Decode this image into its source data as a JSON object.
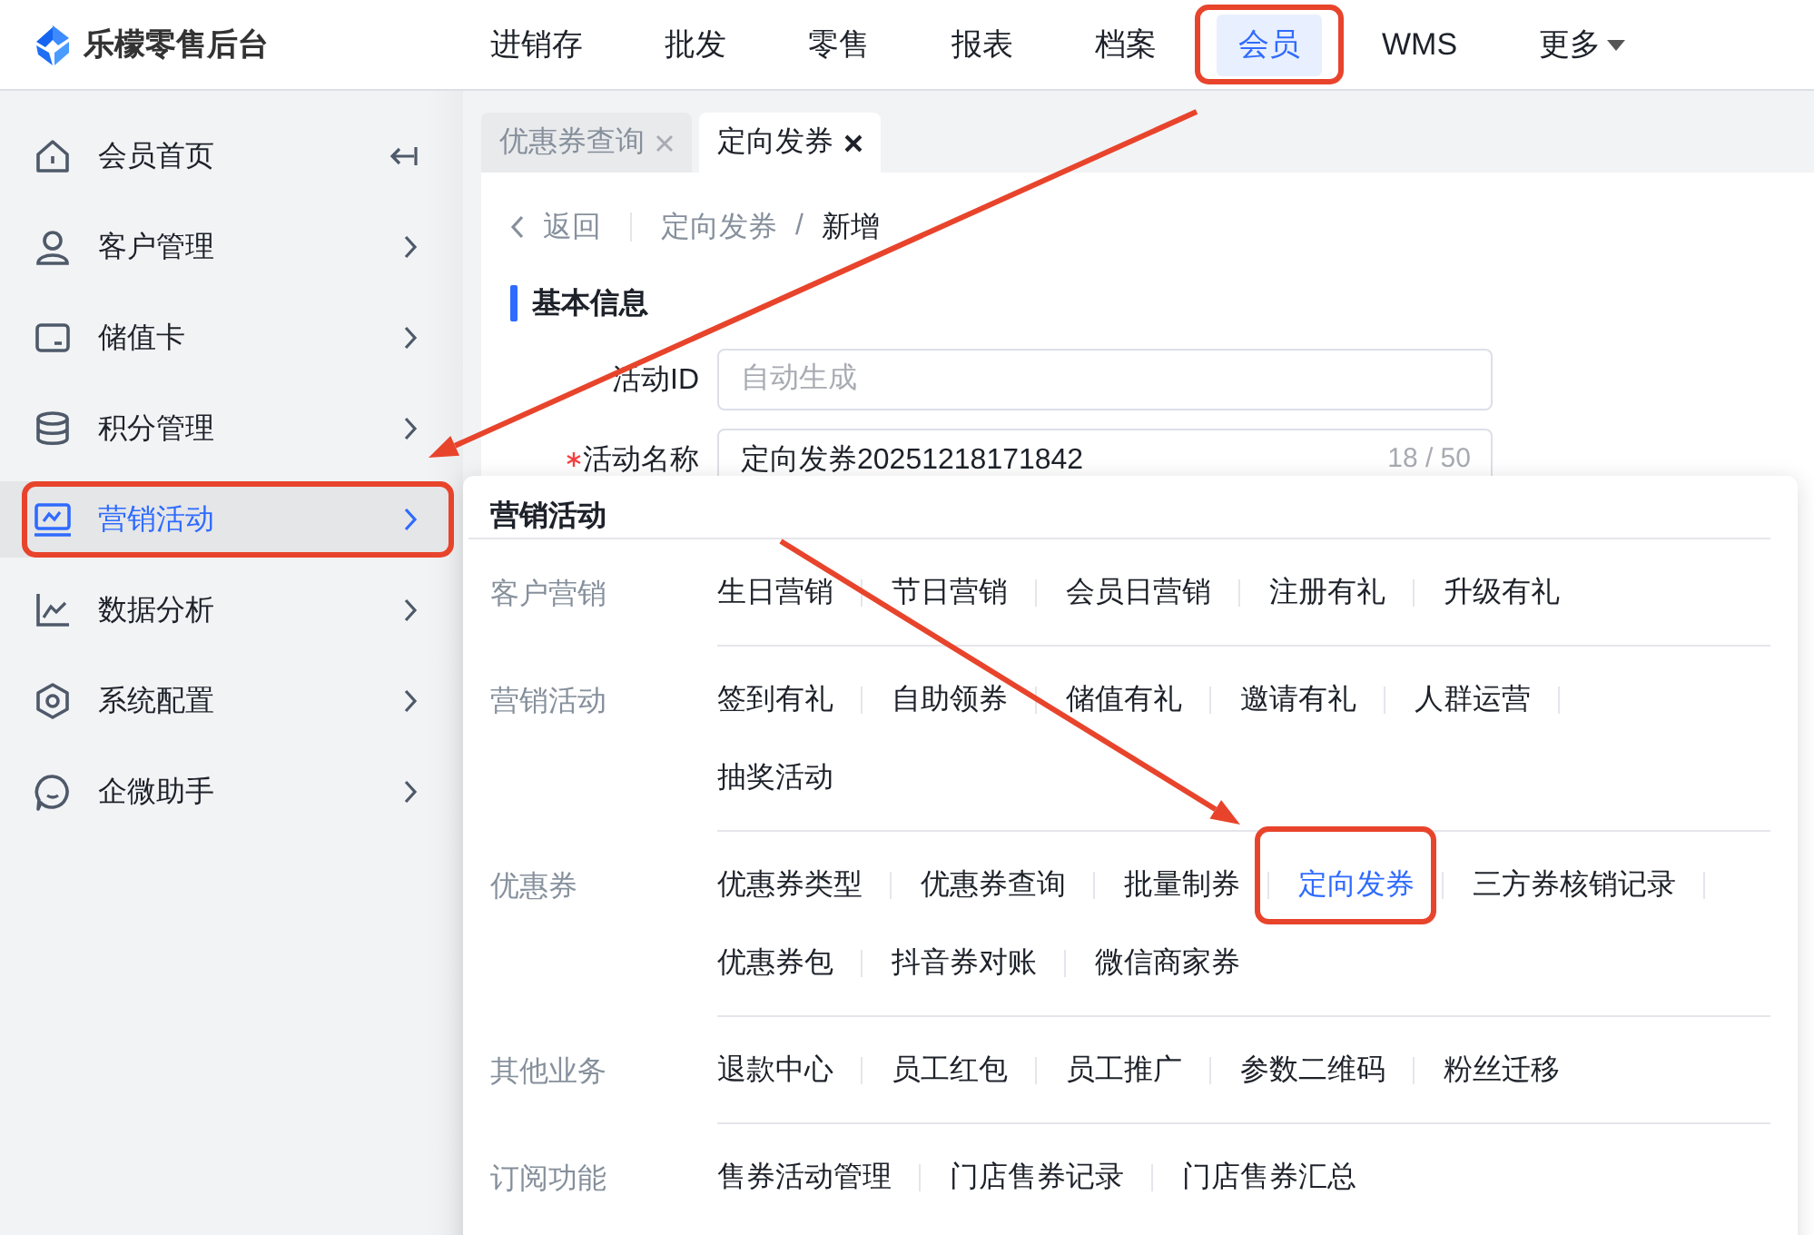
{
  "app": {
    "title": "乐檬零售后台"
  },
  "nav": [
    {
      "label": "进销存",
      "kind": "link",
      "selected": false,
      "highlighted": false
    },
    {
      "label": "批发",
      "kind": "link",
      "selected": false,
      "highlighted": false
    },
    {
      "label": "零售",
      "kind": "link",
      "selected": false,
      "highlighted": false
    },
    {
      "label": "报表",
      "kind": "link",
      "selected": false,
      "highlighted": false
    },
    {
      "label": "档案",
      "kind": "link",
      "selected": false,
      "highlighted": false
    },
    {
      "label": "会员",
      "kind": "link",
      "selected": true,
      "highlighted": true
    },
    {
      "label": "WMS",
      "kind": "link",
      "selected": false,
      "highlighted": false
    },
    {
      "label": "更多",
      "kind": "dropdown",
      "selected": false,
      "highlighted": false
    }
  ],
  "sidebar": {
    "items": [
      {
        "label": "会员首页",
        "kind": "collapse",
        "selected": false,
        "highlighted": false
      },
      {
        "label": "客户管理",
        "kind": "submenu",
        "selected": false,
        "highlighted": false
      },
      {
        "label": "储值卡",
        "kind": "submenu",
        "selected": false,
        "highlighted": false
      },
      {
        "label": "积分管理",
        "kind": "submenu",
        "selected": false,
        "highlighted": false
      },
      {
        "label": "营销活动",
        "kind": "submenu",
        "selected": true,
        "highlighted": true
      },
      {
        "label": "数据分析",
        "kind": "submenu",
        "selected": false,
        "highlighted": false
      },
      {
        "label": "系统配置",
        "kind": "submenu",
        "selected": false,
        "highlighted": false
      },
      {
        "label": "企微助手",
        "kind": "submenu",
        "selected": false,
        "highlighted": false
      }
    ]
  },
  "tabs": [
    {
      "label": "优惠券查询",
      "selected": false
    },
    {
      "label": "定向发券",
      "selected": true
    }
  ],
  "breadcrumb": {
    "back": "返回",
    "items": [
      "定向发券",
      "新增"
    ],
    "separator": "/"
  },
  "section": {
    "title": "基本信息"
  },
  "fields": [
    {
      "label": "活动ID",
      "required": false,
      "placeholder": "自动生成"
    },
    {
      "label": "活动名称",
      "required": true,
      "value": "定向发券20251218171842",
      "counter": "18 / 50"
    }
  ],
  "menu": {
    "title": "营销活动",
    "groups": [
      {
        "label": "客户营销",
        "items": [
          {
            "label": "生日营销",
            "selected": false,
            "highlighted": false
          },
          {
            "label": "节日营销",
            "selected": false,
            "highlighted": false
          },
          {
            "label": "会员日营销",
            "selected": false,
            "highlighted": false
          },
          {
            "label": "注册有礼",
            "selected": false,
            "highlighted": false
          },
          {
            "label": "升级有礼",
            "selected": false,
            "highlighted": false
          }
        ]
      },
      {
        "label": "营销活动",
        "items": [
          {
            "label": "签到有礼",
            "selected": false,
            "highlighted": false
          },
          {
            "label": "自助领券",
            "selected": false,
            "highlighted": false
          },
          {
            "label": "储值有礼",
            "selected": false,
            "highlighted": false
          },
          {
            "label": "邀请有礼",
            "selected": false,
            "highlighted": false
          },
          {
            "label": "人群运营",
            "selected": false,
            "highlighted": false
          },
          {
            "label": "抽奖活动",
            "selected": false,
            "highlighted": false
          }
        ]
      },
      {
        "label": "优惠券",
        "items": [
          {
            "label": "优惠券类型",
            "selected": false,
            "highlighted": false
          },
          {
            "label": "优惠券查询",
            "selected": false,
            "highlighted": false
          },
          {
            "label": "批量制券",
            "selected": false,
            "highlighted": false
          },
          {
            "label": "定向发券",
            "selected": true,
            "highlighted": true
          },
          {
            "label": "三方券核销记录",
            "selected": false,
            "highlighted": false
          },
          {
            "label": "优惠券包",
            "selected": false,
            "highlighted": false
          },
          {
            "label": "抖音券对账",
            "selected": false,
            "highlighted": false
          },
          {
            "label": "微信商家券",
            "selected": false,
            "highlighted": false
          }
        ]
      },
      {
        "label": "其他业务",
        "items": [
          {
            "label": "退款中心",
            "selected": false,
            "highlighted": false
          },
          {
            "label": "员工红包",
            "selected": false,
            "highlighted": false
          },
          {
            "label": "员工推广",
            "selected": false,
            "highlighted": false
          },
          {
            "label": "参数二维码",
            "selected": false,
            "highlighted": false
          },
          {
            "label": "粉丝迁移",
            "selected": false,
            "highlighted": false
          }
        ]
      },
      {
        "label": "订阅功能",
        "items": [
          {
            "label": "售券活动管理",
            "selected": false,
            "highlighted": false
          },
          {
            "label": "门店售券记录",
            "selected": false,
            "highlighted": false
          },
          {
            "label": "门店售券汇总",
            "selected": false,
            "highlighted": false
          }
        ]
      }
    ]
  }
}
